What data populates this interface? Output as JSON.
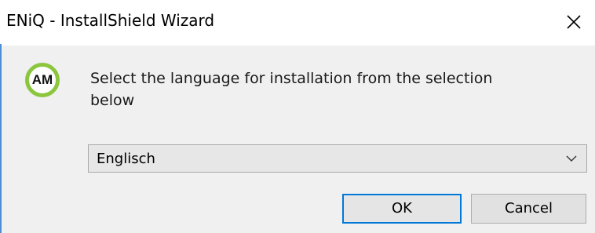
{
  "window": {
    "title": "ENiQ  - InstallShield Wizard",
    "close_icon": "close-icon"
  },
  "logo": {
    "text": "AM",
    "ring_color": "#8cc63f"
  },
  "prompt": {
    "text": "Select the language for installation from the selection below"
  },
  "language_select": {
    "selected_value": "Englisch",
    "arrow_icon": "chevron-down-icon"
  },
  "buttons": {
    "ok_label": "OK",
    "cancel_label": "Cancel"
  },
  "colors": {
    "accent": "#0078d7",
    "body_background": "#f0f0f0"
  }
}
